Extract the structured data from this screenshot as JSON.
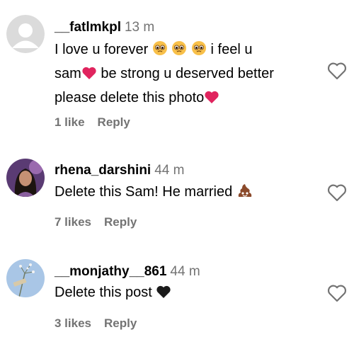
{
  "comments": [
    {
      "username": "__fatlmkpl",
      "time": "13 m",
      "lines": [
        [
          "I love u forever ",
          " ",
          " ",
          " ",
          "i feel u"
        ],
        [
          "sam",
          " be strong u deserved better"
        ],
        [
          "please delete this photo",
          ""
        ]
      ],
      "likes": "1 like",
      "reply": "Reply",
      "avatar": "default-gray-avatar"
    },
    {
      "username": "rhena_darshini",
      "time": "44 m",
      "lines": [
        [
          "Delete this Sam! He married "
        ]
      ],
      "likes": "7 likes",
      "reply": "Reply",
      "avatar": "woman-photo-avatar"
    },
    {
      "username": "__monjathy__861",
      "time": "44 m",
      "lines": [
        [
          "Delete this post "
        ]
      ],
      "likes": "3 likes",
      "reply": "Reply",
      "avatar": "flower-photo-avatar"
    }
  ],
  "colors": {
    "secondary_text": "#737373",
    "heart_red": "#e0245e",
    "text": "#000000"
  }
}
